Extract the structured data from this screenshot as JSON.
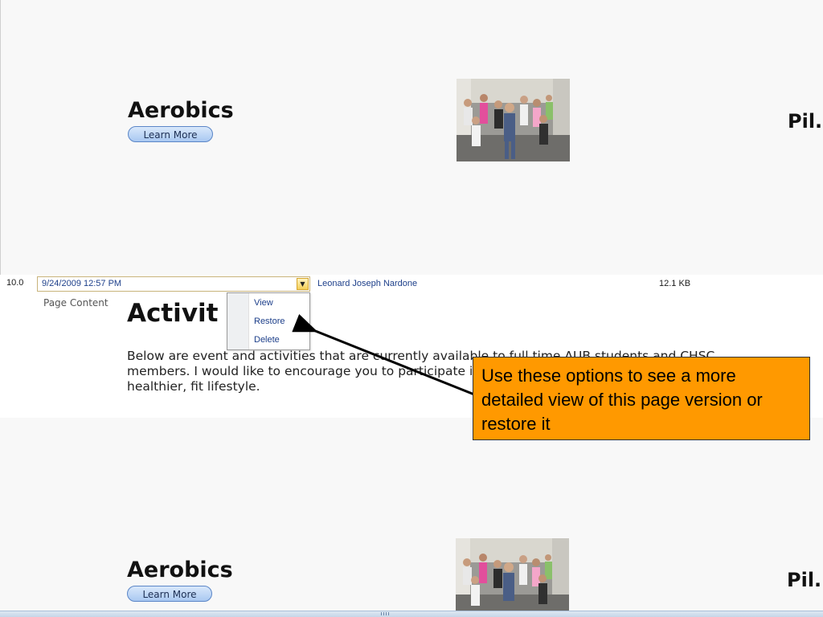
{
  "top_preview": {
    "title": "Aerobics",
    "learn_more": "Learn More",
    "edge_title": "Pil..."
  },
  "bottom_preview": {
    "title": "Aerobics",
    "learn_more": "Learn More",
    "edge_title": "Pil..."
  },
  "version_row": {
    "number": "10.0",
    "date": "9/24/2009 12:57 PM",
    "author": "Leonard Joseph Nardone",
    "size": "12.1 KB"
  },
  "field_label": "Page Content",
  "content": {
    "heading": "Activit",
    "body_lines": [
      "Below are event and activities that are currently available to full time AUB students and CHSC",
      "members. I would like  to encourage you to participate in these activities to help you lead a",
      "healthier, fit lifestyle."
    ]
  },
  "menu": {
    "items": [
      "View",
      "Restore",
      "Delete"
    ]
  },
  "callout": {
    "text": "Use these options to see a more detailed view of this page version or restore it"
  },
  "colors": {
    "callout_bg": "#ff9900",
    "link": "#1d3f8a",
    "preview_bg": "#f8f8f8"
  },
  "icons": {
    "dropdown": "chevron-down-icon",
    "arrow": "pointer-arrow-icon",
    "photo": "aerobics-class-photo"
  }
}
